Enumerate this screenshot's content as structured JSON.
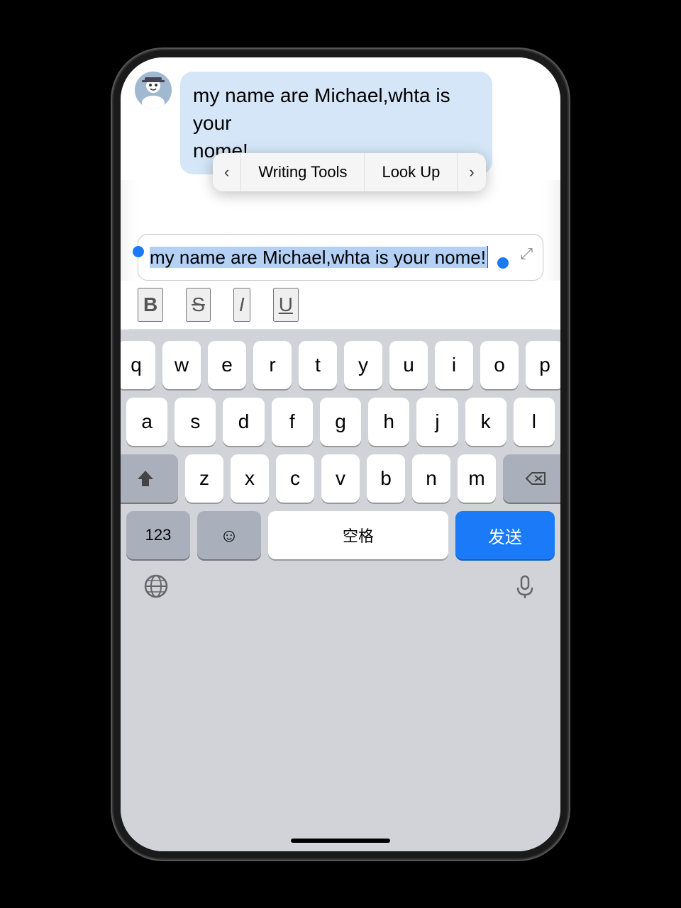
{
  "phone": {
    "chat": {
      "message_text": "my name are Michael,whta is your nome!",
      "message_text_line1": "my name are Michael,whta is your",
      "message_text_line2": "nome!"
    },
    "context_menu": {
      "prev_label": "‹",
      "next_label": "›",
      "writing_tools_label": "Writing Tools",
      "look_up_label": "Look Up"
    },
    "input": {
      "text": "my name are Michael,whta is your nome!",
      "expand_icon": "⤢"
    },
    "format_toolbar": {
      "bold_label": "B",
      "strikethrough_label": "S",
      "italic_label": "I",
      "underline_label": "U"
    },
    "keyboard": {
      "rows": [
        [
          "q",
          "w",
          "e",
          "r",
          "t",
          "y",
          "u",
          "i",
          "o",
          "p"
        ],
        [
          "a",
          "s",
          "d",
          "f",
          "g",
          "h",
          "j",
          "k",
          "l"
        ],
        [
          "z",
          "x",
          "c",
          "v",
          "b",
          "n",
          "m"
        ]
      ],
      "space_label": "空格",
      "numbers_label": "123",
      "send_label": "发送"
    }
  }
}
